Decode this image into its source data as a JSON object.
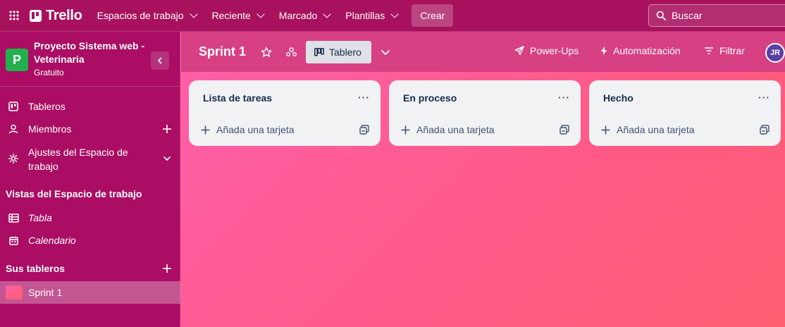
{
  "topnav": {
    "brand": "Trello",
    "menus": [
      "Espacios de trabajo",
      "Reciente",
      "Marcado",
      "Plantillas"
    ],
    "create_label": "Crear",
    "search_label": "Buscar"
  },
  "sidebar": {
    "workspace_initial": "P",
    "workspace_name": "Proyecto Sistema web - Veterinaria",
    "workspace_plan": "Gratuito",
    "items": [
      "Tableros",
      "Miembros",
      "Ajustes del Espacio de trabajo"
    ],
    "views_heading": "Vistas del Espacio de trabajo",
    "views": [
      "Tabla",
      "Calendario"
    ],
    "boards_heading": "Sus tableros",
    "boards": [
      "Sprint 1"
    ]
  },
  "board": {
    "title": "Sprint 1",
    "view_label": "Tablero",
    "powerups_label": "Power-Ups",
    "automation_label": "Automatización",
    "filter_label": "Filtrar",
    "member_initials": "JR"
  },
  "lists": [
    {
      "title": "Lista de tareas",
      "add_label": "Añada una tarjeta"
    },
    {
      "title": "En proceso",
      "add_label": "Añada una tarjeta"
    },
    {
      "title": "Hecho",
      "add_label": "Añada una tarjeta"
    }
  ],
  "colors": {
    "nav": "#a8115e",
    "sidebar": "#aa0d63",
    "canvas": "#ff5f9e",
    "workspace_avatar": "#22b14c",
    "list_bg": "#f1f2f4"
  }
}
